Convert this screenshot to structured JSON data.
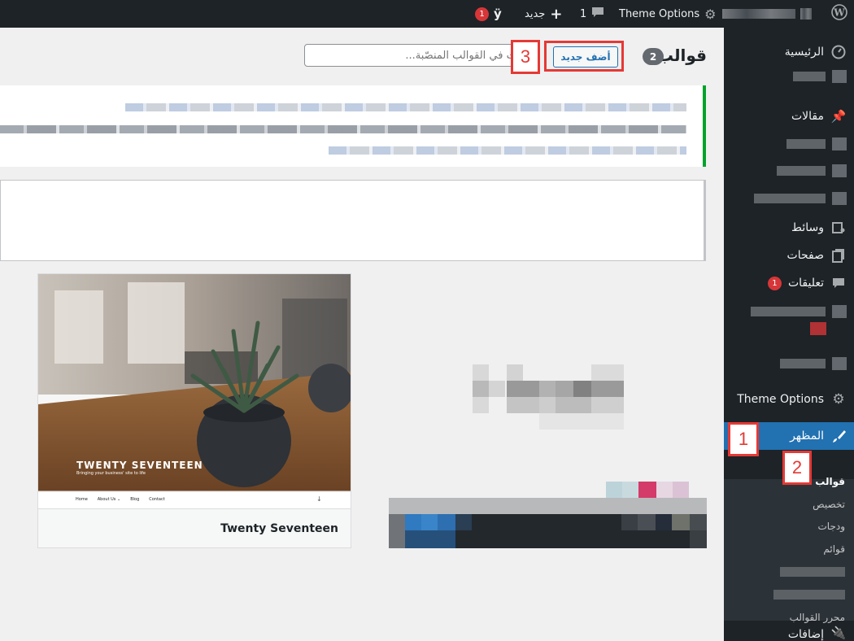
{
  "adminbar": {
    "theme_options": "Theme Options",
    "comments_count": "1",
    "new_label": "جديد",
    "yoast_badge": "1"
  },
  "sidebar": {
    "items": [
      {
        "label": "الرئيسية",
        "icon": "dashboard-icon"
      },
      {
        "label": "مقالات",
        "icon": "pin-icon"
      },
      {
        "label": "وسائط",
        "icon": "media-icon"
      },
      {
        "label": "صفحات",
        "icon": "pages-icon"
      },
      {
        "label": "تعليقات",
        "icon": "comments-icon",
        "badge": "1"
      },
      {
        "label": "Theme Options",
        "icon": "gear-icon"
      },
      {
        "label": "المظهر",
        "icon": "brush-icon"
      },
      {
        "label": "إضافات",
        "icon": "plugin-icon"
      }
    ],
    "appearance_submenu": [
      "قوالب",
      "تخصيص",
      "ودجات",
      "قوائم",
      "محرر القوالب"
    ]
  },
  "header": {
    "title": "قوالب",
    "count": "2",
    "add_new": "أضف جديد",
    "search_placeholder": "ابحث في القوالب المنصّبة..."
  },
  "markers": [
    "1",
    "2",
    "3"
  ],
  "themes": [
    {
      "name": "Twenty Seventeen",
      "screenshot_title": "TWENTY SEVENTEEN",
      "screenshot_tagline": "Bringing your business' site to life",
      "screenshot_nav": [
        "Home",
        "About Us ⌄",
        "Blog",
        "Contact"
      ]
    }
  ],
  "colors": {
    "admin_bg": "#1d2327",
    "accent": "#2271b1",
    "notice_border": "#00a32a",
    "marker": "#e53935"
  }
}
